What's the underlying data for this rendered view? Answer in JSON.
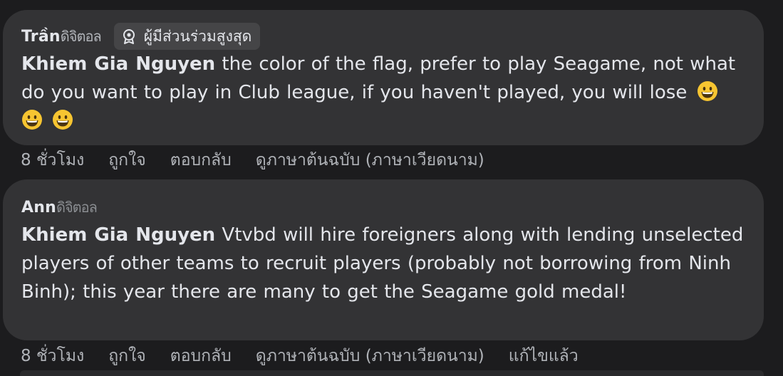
{
  "comments": [
    {
      "author_prefix": "Trần",
      "author_suffix": "ดิจิตอล",
      "badge": {
        "icon": "top-fan-badge-icon",
        "label": "ผู้มีส่วนร่วมสูงสุด"
      },
      "mention": "Khiem Gia Nguyen",
      "text": " the color of the flag, prefer to play Seagame, not what do you want to play in Club league, if you haven't played, you will lose",
      "emoji_count": 3,
      "emoji": "grinning-face-emoji",
      "actions": {
        "time": "8 ชั่วโมง",
        "like": "ถูกใจ",
        "reply": "ตอบกลับ",
        "see_original": "ดูภาษาต้นฉบับ (ภาษาเวียดนาม)"
      }
    },
    {
      "author_prefix": "Ann",
      "author_suffix": "ดิจิตอล",
      "mention": "Khiem Gia Nguyen",
      "text": " Vtvbd will hire foreigners along with lending unselected players of other teams to recruit players (probably not borrowing from Ninh Binh); this year there are many to get the Seagame gold medal!",
      "actions": {
        "time": "8 ชั่วโมง",
        "like": "ถูกใจ",
        "reply": "ตอบกลับ",
        "see_original": "ดูภาษาต้นฉบับ (ภาษาเวียดนาม)",
        "edited": "แก้ไขแล้ว"
      }
    }
  ],
  "colors": {
    "background": "#1c1c1e",
    "bubble": "#333335",
    "badge": "#454547",
    "text_primary": "#e4e6eb",
    "text_secondary": "#b0b3b8"
  }
}
